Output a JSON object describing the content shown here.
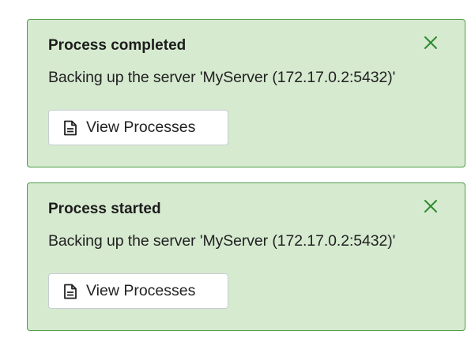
{
  "notifications": [
    {
      "title": "Process completed",
      "message": "Backing up the server 'MyServer (172.17.0.2:5432)'",
      "button_label": "View Processes",
      "close_icon": "close-icon",
      "button_icon": "document-icon"
    },
    {
      "title": "Process started",
      "message": "Backing up the server 'MyServer (172.17.0.2:5432)'",
      "button_label": "View Processes",
      "close_icon": "close-icon",
      "button_icon": "document-icon"
    }
  ],
  "colors": {
    "toast_background": "#d6ead0",
    "toast_border": "#4d9b48",
    "close_icon": "#2e8b2e",
    "text": "#222222"
  }
}
